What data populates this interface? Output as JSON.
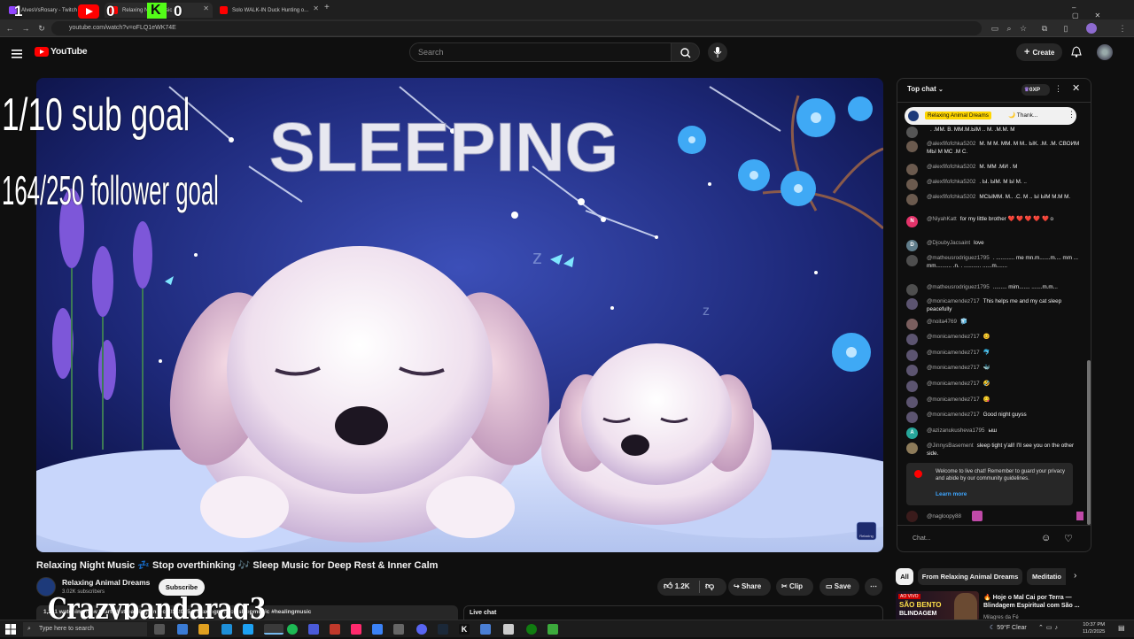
{
  "browser": {
    "tabs": [
      {
        "label": "AlvesVsRosary - Twitch",
        "active": false
      },
      {
        "label": "Relaxing Night Music",
        "active": true
      },
      {
        "label": "Solo WALK-IN Duck Hunting o...",
        "active": false
      }
    ],
    "url": "youtube.com/watch?v=oFLQ1eWK74E"
  },
  "stream_overlay": {
    "counters": [
      "1",
      "0",
      "0"
    ],
    "sub_goal": "1/10 sub goal",
    "follower_goal": "164/250 follower goal",
    "streamer_name": "Crazypandarag3"
  },
  "youtube": {
    "logo_text": "YouTube",
    "search_placeholder": "Search",
    "create_label": "Create"
  },
  "video": {
    "thumbnail_text": "SLEEPING",
    "watermark": "Relaxing",
    "title": "Relaxing Night Music 💤 Stop overthinking 🎶 Sleep Music for Deep Rest & Inner Calm",
    "channel_name": "Relaxing Animal Dreams",
    "subscribers": "3.02K subscribers",
    "subscribe_label": "Subscribe",
    "like_count": "1.2K",
    "share_label": "Share",
    "clip_label": "Clip",
    "save_label": "Save",
    "description_snippet": "1,211 watching now  Started streaming on Oct 31 2025  #relaxingmusic #sleepmusic #healingmusic",
    "live_chat_label": "Live chat"
  },
  "chat": {
    "header": "Top chat",
    "points": "0XP",
    "pinned_name": "Relaxing Animal Dreams",
    "pinned_text": "🌙 Thank...",
    "messages": [
      {
        "author": "",
        "text": ". .ММ. В. ММ.М.ЫМ .. М. .М.М. М",
        "avatar_color": "#555555",
        "avatar_letter": ""
      },
      {
        "author": "@alexfifofchka5202",
        "text": "М. М М. ММ. М М.. ЫК. .М. .М. СВОИМ МЫ М МС .М С.",
        "avatar_color": "#6b5a4e",
        "avatar_letter": ""
      },
      {
        "author": "@alexfifofchka5202",
        "text": "М. ММ .МИ . М",
        "avatar_color": "#6b5a4e",
        "avatar_letter": ""
      },
      {
        "author": "@alexfifofchka5202",
        "text": ". Ы. ЫМ. М Ы М. ..",
        "avatar_color": "#6b5a4e",
        "avatar_letter": ""
      },
      {
        "author": "@alexfifofchka5202",
        "text": "МСЫММ. М.. .С. М .. Ы ЫМ М.М М.",
        "avatar_color": "#6b5a4e",
        "avatar_letter": ""
      },
      {
        "author": "@NiyahKatt",
        "text": "for my little brother ❤️ ❤️ ❤️ ❤️ ❤️ o",
        "avatar_color": "#e3336a",
        "avatar_letter": "N"
      },
      {
        "author": "@DjoubyJacsaint",
        "text": "love",
        "avatar_color": "#607d8b",
        "avatar_letter": "D"
      },
      {
        "author": "@matheusrodriguez1795",
        "text": ". ............ me mn.m.......m.... mm ... mm.......... .n. . ........... ......m.......",
        "avatar_color": "#4e4e4e",
        "avatar_letter": ""
      },
      {
        "author": "@matheusrodriguez1795",
        "text": "......... mim....... .......m.m...",
        "avatar_color": "#4e4e4e",
        "avatar_letter": ""
      },
      {
        "author": "@monicamendez717",
        "text": "This helps me and my cat sleep peacefully",
        "avatar_color": "#5c5470",
        "avatar_letter": ""
      },
      {
        "author": "@noita4769",
        "text": "🧊",
        "avatar_color": "#7a5e5e",
        "avatar_letter": ""
      },
      {
        "author": "@monicamendez717",
        "text": "😊",
        "avatar_color": "#5c5470",
        "avatar_letter": ""
      },
      {
        "author": "@monicamendez717",
        "text": "🐬",
        "avatar_color": "#5c5470",
        "avatar_letter": ""
      },
      {
        "author": "@monicamendez717",
        "text": "🐳",
        "avatar_color": "#5c5470",
        "avatar_letter": ""
      },
      {
        "author": "@monicamendez717",
        "text": "🤣",
        "avatar_color": "#5c5470",
        "avatar_letter": ""
      },
      {
        "author": "@monicamendez717",
        "text": "😋",
        "avatar_color": "#5c5470",
        "avatar_letter": ""
      },
      {
        "author": "@monicamendez717",
        "text": "Good night guyss",
        "avatar_color": "#5c5470",
        "avatar_letter": ""
      },
      {
        "author": "@azizanukusheva1795",
        "text": "ыш",
        "avatar_color": "#26a69a",
        "avatar_letter": "A"
      },
      {
        "author": "@JinnysBasement",
        "text": "sleep tight y'all! I'll see you on the other side.",
        "avatar_color": "#8d7b5a",
        "avatar_letter": ""
      }
    ],
    "notice_text": "Welcome to live chat! Remember to guard your privacy and abide by our community guidelines.",
    "notice_link": "Learn more",
    "last_author": "@nagloopy88",
    "input_placeholder": "Chat..."
  },
  "chips": [
    "All",
    "From Relaxing Animal Dreams",
    "Meditatio"
  ],
  "recommendation": {
    "badge": "AO VIVO",
    "thumb_text": "SÃO BENTO",
    "thumb_subtext": "BLINDAGEM",
    "title": "🔥 Hoje o Mal Cai por Terra — Blindagem Espiritual com São ...",
    "channel": "Milagres da Fé"
  },
  "taskbar": {
    "search_placeholder": "Type here to search",
    "weather": "59°F  Clear",
    "time": "10:37 PM",
    "date": "11/2/2025"
  }
}
